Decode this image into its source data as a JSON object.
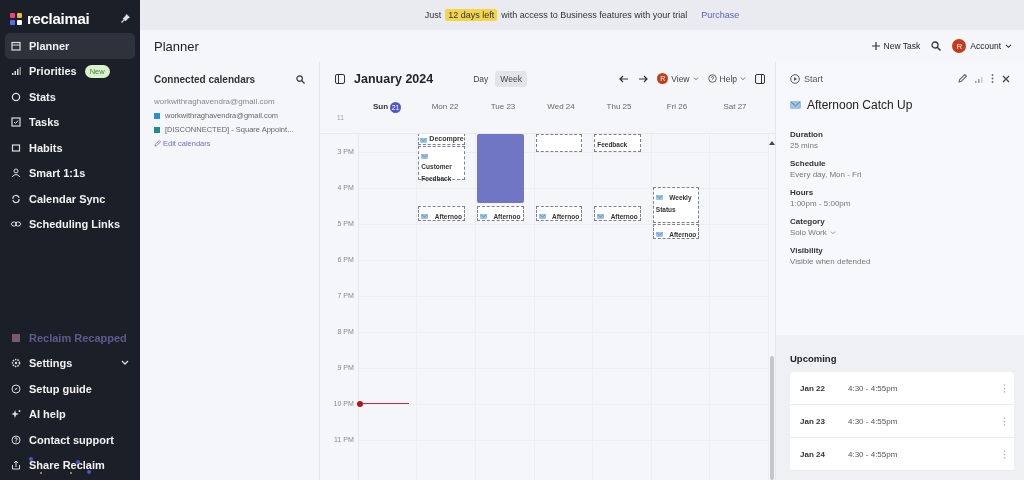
{
  "sidebar": {
    "logo": "reclaimai",
    "items": [
      {
        "label": "Planner",
        "selected": true
      },
      {
        "label": "Priorities",
        "selected": false,
        "badge": "New"
      },
      {
        "label": "Stats",
        "selected": false
      },
      {
        "label": "Tasks",
        "selected": false
      },
      {
        "label": "Habits",
        "selected": false
      },
      {
        "label": "Smart 1:1s",
        "selected": false
      },
      {
        "label": "Calendar Sync",
        "selected": false
      },
      {
        "label": "Scheduling Links",
        "selected": false
      }
    ],
    "bottom_items": [
      {
        "label": "Reclaim Recapped",
        "kind": "promo"
      },
      {
        "label": "Settings",
        "kind": "menu"
      },
      {
        "label": "Setup guide",
        "kind": "link"
      },
      {
        "label": "AI help",
        "kind": "link"
      },
      {
        "label": "Contact support",
        "kind": "link"
      },
      {
        "label": "Share Reclaim",
        "kind": "share"
      }
    ]
  },
  "banner": {
    "before": "Just",
    "highlight": "12 days left",
    "after": "with access to Business features with your trial",
    "link": "Purchase"
  },
  "header": {
    "title": "Planner",
    "new_task": "New Task",
    "account": "Account",
    "avatar": "R"
  },
  "calendars": {
    "title": "Connected calendars",
    "account": "workwithraghavendra@gmail.com",
    "items": [
      {
        "label": "workwithraghavendra@gmail.com",
        "color": "#2a8fd0"
      },
      {
        "label": "[DISCONNECTED] - Square Appoint...",
        "color": "#1e8c7e"
      }
    ],
    "edit": "Edit calendars"
  },
  "calendar": {
    "title": "January 2024",
    "views": [
      {
        "label": "Day",
        "selected": false
      },
      {
        "label": "Week",
        "selected": true
      }
    ],
    "view_menu": "View",
    "view_avatar": "R",
    "help": "Help",
    "corner_label": "11",
    "days": [
      {
        "label": "Sun",
        "date": "21",
        "today": true
      },
      {
        "label": "Mon",
        "date": "22",
        "today": false,
        "events": [
          {
            "kind": "dashed",
            "title": "Decompre",
            "has_icon": true
          },
          {
            "kind": "dashed",
            "title": "Customer Feedback",
            "has_icon": true
          },
          {
            "kind": "dashed",
            "title": "Afternoo",
            "has_icon": true
          }
        ]
      },
      {
        "label": "Tue",
        "date": "23",
        "today": false,
        "events": [
          {
            "kind": "solid",
            "has_icon": false
          },
          {
            "kind": "dashed",
            "title": "Afternoo",
            "has_icon": true
          }
        ]
      },
      {
        "label": "Wed",
        "date": "24",
        "today": false,
        "events": [
          {
            "kind": "dashed",
            "has_icon": false
          },
          {
            "kind": "dashed",
            "title": "Afternoo",
            "has_icon": true
          }
        ]
      },
      {
        "label": "Thu",
        "date": "25",
        "today": false,
        "events": [
          {
            "kind": "dashed",
            "title": "Feedback",
            "has_icon": false
          },
          {
            "kind": "dashed",
            "title": "Afternoo",
            "has_icon": true
          }
        ]
      },
      {
        "label": "Fri",
        "date": "26",
        "today": false,
        "events": [
          {
            "kind": "dashed",
            "title": "Weekly Status",
            "has_icon": true
          },
          {
            "kind": "dashed",
            "title": "Afternoo",
            "has_icon": true
          }
        ]
      },
      {
        "label": "Sat",
        "date": "27",
        "today": false
      }
    ],
    "hours": [
      "3 PM",
      "4 PM",
      "5 PM",
      "6 PM",
      "7 PM",
      "8 PM",
      "9 PM",
      "10 PM",
      "11 PM"
    ]
  },
  "detail": {
    "start": "Start",
    "title": "Afternoon Catch Up",
    "fields": [
      {
        "label": "Duration",
        "value": "25 mins",
        "dropdown": false
      },
      {
        "label": "Schedule",
        "value": "Every day, Mon - Fri",
        "dropdown": false
      },
      {
        "label": "Hours",
        "value": "1:00pm - 5:00pm",
        "dropdown": false
      },
      {
        "label": "Category",
        "value": "Solo Work",
        "dropdown": true
      },
      {
        "label": "Visibility",
        "value": "Visible when defended",
        "dropdown": false
      }
    ],
    "upcoming_title": "Upcoming",
    "upcoming": [
      {
        "date": "Jan 22",
        "time": "4:30 - 4:55pm"
      },
      {
        "date": "Jan 23",
        "time": "4:30 - 4:55pm"
      },
      {
        "date": "Jan 24",
        "time": "4:30 - 4:55pm"
      }
    ]
  }
}
